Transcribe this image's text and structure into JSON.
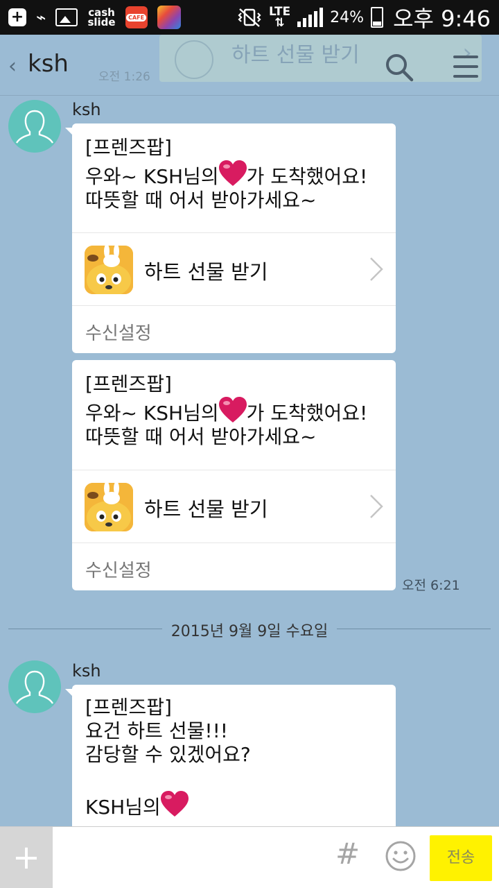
{
  "status_bar": {
    "left_icons": [
      "plus-icon",
      "usb-icon",
      "image-icon",
      "cashslide-icon",
      "cafe-icon",
      "cube-app-icon"
    ],
    "cash_line1": "cash",
    "cash_line2": "slide",
    "cafe": "CAFE",
    "network": "LTE",
    "battery_percent": "24%",
    "time": "오후 9:46"
  },
  "header": {
    "back_icon": "‹",
    "title": "ksh",
    "ghost_time": "오전 1:26",
    "ghost_banner_label": "하트 선물 받기"
  },
  "chat": {
    "message1": {
      "sender": "ksh",
      "cards": [
        {
          "line1": "[프렌즈팝]",
          "line2_before": "우와~ KSH님의",
          "line2_after": "가 도착했어요!",
          "line3": "따뜻할 때 어서 받아가세요~",
          "gift_label": "하트 선물 받기",
          "settings": "수신설정"
        },
        {
          "line1": "[프렌즈팝]",
          "line2_before": "우와~ KSH님의",
          "line2_after": "가 도착했어요!",
          "line3": "따뜻할 때 어서 받아가세요~",
          "gift_label": "하트 선물 받기",
          "settings": "수신설정"
        }
      ],
      "time": "오전 6:21"
    },
    "date_divider": "2015년 9월 9일 수요일",
    "message2": {
      "sender": "ksh",
      "line1": "[프렌즈팝]",
      "line2": "요건 하트 선물!!!",
      "line3": "감당할 수 있겠어요?",
      "line5": "KSH님의"
    }
  },
  "input_bar": {
    "plus_label": "+",
    "message_placeholder": "",
    "hash_label": "#",
    "send_label": "전송"
  },
  "colors": {
    "chat_background": "#9bbbd4",
    "avatar": "#5fc3bb",
    "send_button": "#fff200",
    "heart": "#d81b60"
  }
}
